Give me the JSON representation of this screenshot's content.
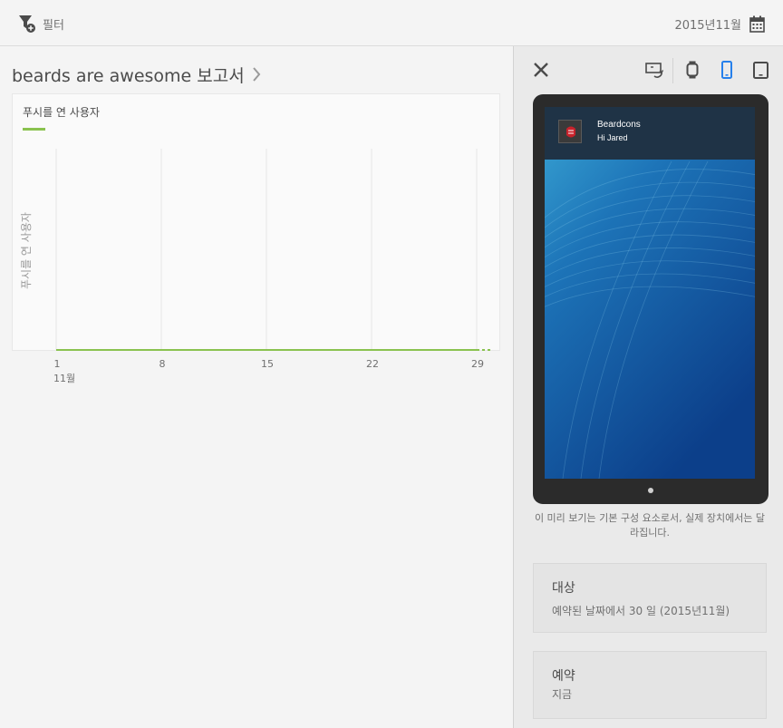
{
  "toolbar": {
    "filter_label": "필터",
    "date_label": "2015년11월"
  },
  "report": {
    "title": "beards are awesome 보고서"
  },
  "chart_data": {
    "type": "line",
    "title": "푸시를 연 사용자",
    "ylabel": "푸시를 연 사용자",
    "xlabel": "",
    "x_tick_labels": [
      "1",
      "8",
      "15",
      "22",
      "29"
    ],
    "x_tick_sublabel": "11월",
    "x_range": [
      1,
      30
    ],
    "series": [
      {
        "name": "",
        "color": "#8ac24f",
        "x": [
          1,
          2,
          3,
          4,
          5,
          6,
          7,
          8,
          9,
          10,
          11,
          12,
          13,
          14,
          15,
          16,
          17,
          18,
          19,
          20,
          21,
          22,
          23,
          24,
          25,
          26,
          27,
          28,
          29,
          30
        ],
        "values": [
          0,
          0,
          0,
          0,
          0,
          0,
          0,
          0,
          0,
          0,
          0,
          0,
          0,
          0,
          0,
          0,
          0,
          0,
          0,
          0,
          0,
          0,
          0,
          0,
          0,
          0,
          0,
          0,
          0,
          0
        ]
      }
    ],
    "grid": true
  },
  "preview": {
    "notification_title": "Beardcons",
    "notification_body": "Hi Jared",
    "note": "이 미리 보기는 기본 구성 요소로서, 실제 장치에서는 달라집니다."
  },
  "audience": {
    "heading": "대상",
    "value": "예약된 날짜에서 30 일 (2015년11월)"
  },
  "schedule": {
    "heading": "예약",
    "value": "지금"
  },
  "colors": {
    "accent_green": "#8ac24f",
    "active_device_blue": "#2680eb"
  }
}
